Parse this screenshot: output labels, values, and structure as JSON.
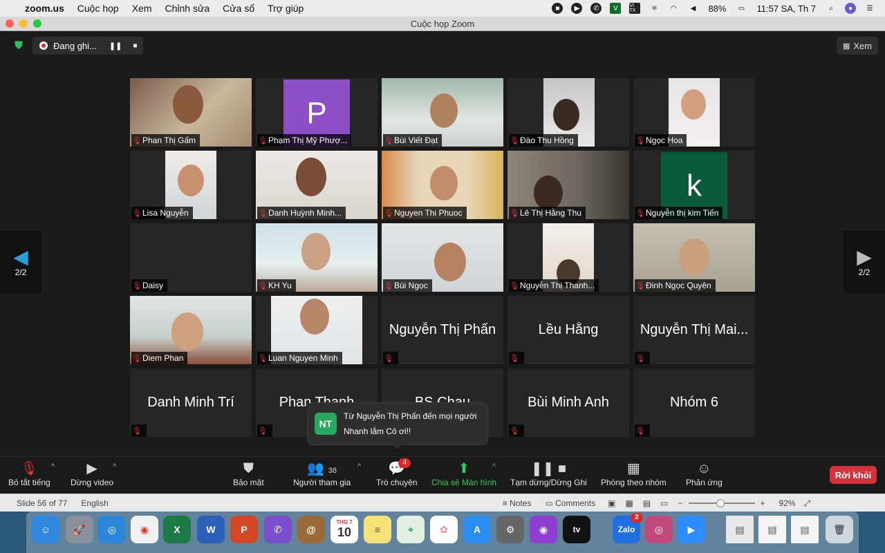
{
  "menubar": {
    "items": [
      "zoom.us",
      "Cuộc họp",
      "Xem",
      "Chỉnh sửa",
      "Cửa sổ",
      "Trợ giúp"
    ],
    "battery": "88%",
    "clock": "11:57 SA, Th 7",
    "v_label": "V",
    "vitx_label": "VI TX"
  },
  "window": {
    "title": "Cuộc họp Zoom"
  },
  "recording": {
    "label": "Đang ghi..."
  },
  "view_button": {
    "label": "Xem"
  },
  "pager": {
    "left": "2/2",
    "right": "2/2"
  },
  "avatars": {
    "p_letter": "P",
    "k_letter": "k"
  },
  "tiles": [
    {
      "name": "Phan Thị Gấm",
      "type": "video"
    },
    {
      "name": "Phạm Thị Mỹ Phượ...",
      "type": "avatar-p"
    },
    {
      "name": "Bùi Viết Đạt",
      "type": "video"
    },
    {
      "name": "Đào Thu Hồng",
      "type": "video"
    },
    {
      "name": "Ngọc Hoa",
      "type": "video"
    },
    {
      "name": "Lisa Nguyễn",
      "type": "video"
    },
    {
      "name": "Danh Huỳnh Minh...",
      "type": "video"
    },
    {
      "name": "Nguyen Thi Phuoc",
      "type": "video"
    },
    {
      "name": "Lê Thị Hằng Thu",
      "type": "video"
    },
    {
      "name": "Nguyễn thị kim Tiến",
      "type": "avatar-k"
    },
    {
      "name": "Daisy",
      "type": "blank"
    },
    {
      "name": "KH Yu",
      "type": "video"
    },
    {
      "name": "Bùi Ngọc",
      "type": "video"
    },
    {
      "name": "Nguyễn Thị Thanh...",
      "type": "video"
    },
    {
      "name": "Đinh Ngọc Quyên",
      "type": "video"
    },
    {
      "name": "Diem Phan",
      "type": "video"
    },
    {
      "name": "Luan Nguyen Minh",
      "type": "video"
    },
    {
      "name": "Nguyễn Thị Phấn",
      "type": "name"
    },
    {
      "name": "Lều Hằng",
      "type": "name"
    },
    {
      "name": "Nguyễn Thị Mai...",
      "type": "name"
    },
    {
      "name": "Danh Minh Trí",
      "type": "name"
    },
    {
      "name": "Phan Thanh",
      "type": "name"
    },
    {
      "name": "BS Chau",
      "type": "name"
    },
    {
      "name": "Bùi Minh Anh",
      "type": "name"
    },
    {
      "name": "Nhóm 6",
      "type": "name"
    }
  ],
  "chat_popup": {
    "initials": "NT",
    "from": "Từ Nguyễn Thị Phấn đến mọi người",
    "message": "Nhanh lắm Cô ơi!!"
  },
  "toolbar": {
    "mute": "Bỏ tắt tiếng",
    "video": "Dừng video",
    "security": "Bảo mật",
    "participants": "Người tham gia",
    "participants_count": "38",
    "chat": "Trò chuyện",
    "chat_badge": "4",
    "share": "Chia sẻ Màn hình",
    "pause": "Tạm dừng/Dừng Ghi",
    "breakout": "Phòng theo nhóm",
    "reactions": "Phản ứng",
    "leave": "Rời khỏi"
  },
  "ppt_status": {
    "slide": "Slide 56 of 77",
    "language": "English",
    "notes": "Notes",
    "comments": "Comments",
    "zoom": "92%"
  },
  "dock": {
    "calendar_month": "THG 7",
    "calendar_day": "10",
    "zalo_label": "Zalo",
    "zalo_badge": "2",
    "tv_label": "tv"
  },
  "colors": {
    "accent_green": "#2fcf5f",
    "leave_red": "#d6323c",
    "mute_red": "#e23636",
    "avatar_purple": "#8e4fc6",
    "avatar_green": "#0b5a3a"
  }
}
